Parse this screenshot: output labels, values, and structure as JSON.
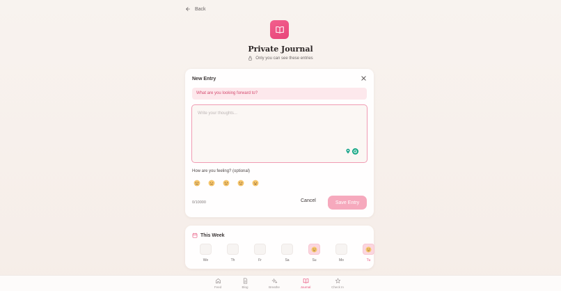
{
  "header": {
    "back_label": "Back",
    "title": "Private Journal",
    "subtitle": "Only you can see these entries"
  },
  "entry": {
    "heading": "New Entry",
    "prompt": "What are you looking forward to?",
    "textarea_placeholder": "Write your thoughts...",
    "textarea_value": "",
    "feeling_label": "How are you feeling? (optional)",
    "moods": [
      "very-sad",
      "sad",
      "neutral",
      "happy",
      "very-happy"
    ],
    "counter": "0/10000",
    "cancel_label": "Cancel",
    "save_label": "Save Entry"
  },
  "week": {
    "heading": "This Week",
    "days": [
      {
        "label": "We",
        "filled": false,
        "today": false
      },
      {
        "label": "Th",
        "filled": false,
        "today": false
      },
      {
        "label": "Fr",
        "filled": false,
        "today": false
      },
      {
        "label": "Sa",
        "filled": false,
        "today": false
      },
      {
        "label": "Su",
        "filled": true,
        "today": false
      },
      {
        "label": "Mo",
        "filled": false,
        "today": false
      },
      {
        "label": "Tu",
        "filled": true,
        "today": true
      }
    ]
  },
  "nav": {
    "items": [
      {
        "label": "Feed",
        "icon": "home-icon",
        "active": false
      },
      {
        "label": "Blog",
        "icon": "document-icon",
        "active": false
      },
      {
        "label": "Breathe",
        "icon": "sparkle-icon",
        "active": false
      },
      {
        "label": "Journal",
        "icon": "book-icon",
        "active": true
      },
      {
        "label": "Check In",
        "icon": "star-icon",
        "active": false
      }
    ]
  },
  "colors": {
    "accent": "#e8537d",
    "prompt_bg": "#fde8ec",
    "save_bg": "#f6a9bd",
    "textarea_border": "#f09bb2"
  }
}
